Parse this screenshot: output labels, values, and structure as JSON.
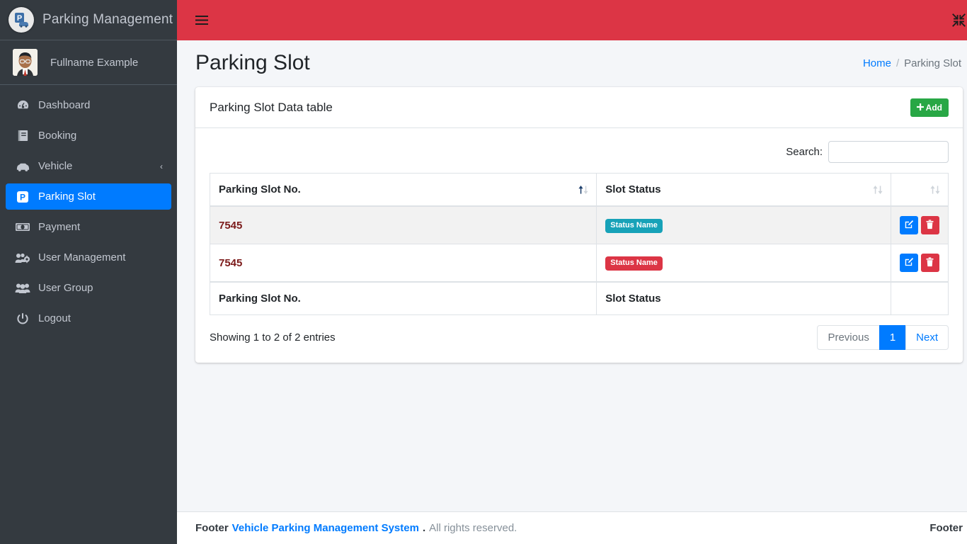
{
  "brand": {
    "title": "Parking Management",
    "logo_icon": "parking-car-logo-icon"
  },
  "user_panel": {
    "name": "Fullname Example",
    "avatar_icon": "user-avatar"
  },
  "sidebar": {
    "items": [
      {
        "label": "Dashboard",
        "icon": "tachometer-icon",
        "active": false,
        "arrow": ""
      },
      {
        "label": "Booking",
        "icon": "book-icon",
        "active": false,
        "arrow": ""
      },
      {
        "label": "Vehicle",
        "icon": "car-icon",
        "active": false,
        "arrow": "‹"
      },
      {
        "label": "Parking Slot",
        "icon": "parking-p-icon",
        "active": true,
        "arrow": ""
      },
      {
        "label": "Payment",
        "icon": "money-bill-icon",
        "active": false,
        "arrow": ""
      },
      {
        "label": "User Management",
        "icon": "users-cog-icon",
        "active": false,
        "arrow": ""
      },
      {
        "label": "User Group",
        "icon": "users-icon",
        "active": false,
        "arrow": ""
      },
      {
        "label": "Logout",
        "icon": "power-off-icon",
        "active": false,
        "arrow": ""
      }
    ]
  },
  "topbar": {
    "menu_icon": "hamburger-menu-icon",
    "fullscreen_icon": "compress-arrows-icon",
    "background_color": "#dc3545"
  },
  "header": {
    "page_title": "Parking Slot",
    "breadcrumb": {
      "home": "Home",
      "separator": "/",
      "current": "Parking Slot"
    }
  },
  "card": {
    "title": "Parking Slot Data table",
    "add_button": {
      "label": "Add",
      "icon": "plus-icon",
      "color": "#28a745"
    }
  },
  "search": {
    "label": "Search:",
    "value": "",
    "placeholder": ""
  },
  "table": {
    "columns": [
      {
        "label": "Parking Slot No.",
        "sort": "asc"
      },
      {
        "label": "Slot Status",
        "sort": "none"
      },
      {
        "label": "",
        "sort": "none"
      }
    ],
    "rows": [
      {
        "slot_no": "7545",
        "status": "Status Name",
        "status_color": "#17a2b8",
        "edit_icon": "edit-pencil-square-icon",
        "delete_icon": "trash-icon"
      },
      {
        "slot_no": "7545",
        "status": "Status Name",
        "status_color": "#dc3545",
        "edit_icon": "edit-pencil-square-icon",
        "delete_icon": "trash-icon"
      }
    ],
    "footer_columns": [
      "Parking Slot No.",
      "Slot Status",
      ""
    ],
    "info": "Showing 1 to 2 of 2 entries",
    "pagination": {
      "previous": "Previous",
      "pages": [
        "1"
      ],
      "current_page": "1",
      "next": "Next"
    }
  },
  "footer": {
    "left_label": "Footer",
    "link": "Vehicle Parking Management System",
    "dot": ".",
    "rights": "All rights reserved.",
    "right_label": "Footer"
  },
  "colors": {
    "accent": "#007bff",
    "danger": "#dc3545",
    "success": "#28a745",
    "info": "#17a2b8",
    "sidebar": "#343a40"
  }
}
